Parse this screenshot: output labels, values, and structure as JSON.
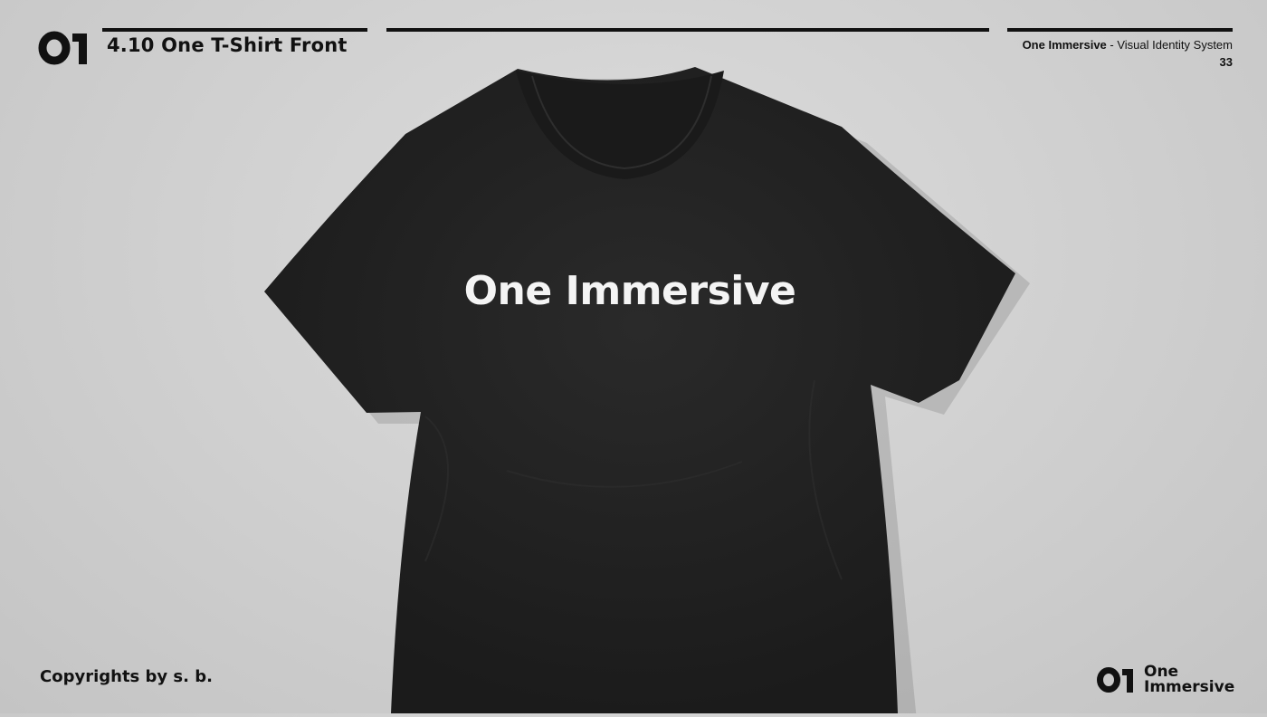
{
  "header": {
    "logo_mark": "01",
    "slide_title": "4.10 One T-Shirt Front",
    "brand": "One Immersive",
    "subtitle": " - Visual Identity System",
    "page_number": "33"
  },
  "mockup": {
    "shirt_print": "One Immersive",
    "shirt_color": "#242424",
    "print_color": "#f4f4f4"
  },
  "footer": {
    "copyright": "Copyrights by s. b.",
    "logo_mark": "01",
    "logo_line1": "One",
    "logo_line2": "Immersive"
  }
}
